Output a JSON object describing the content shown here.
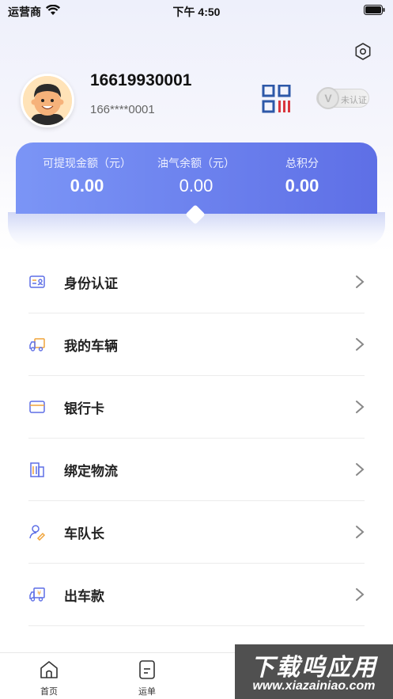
{
  "status_bar": {
    "carrier": "运营商",
    "time": "下午 4:50"
  },
  "profile": {
    "phone": "16619930001",
    "phone_masked": "166****0001",
    "verify_status": "未认证",
    "verify_letter": "V"
  },
  "balances": [
    {
      "label": "可提现金额（元）",
      "value": "0.00"
    },
    {
      "label": "油气余额（元）",
      "value": "0.00"
    },
    {
      "label": "总积分",
      "value": "0.00"
    }
  ],
  "menu": [
    {
      "label": "身份认证",
      "icon": "id-card-icon"
    },
    {
      "label": "我的车辆",
      "icon": "truck-icon"
    },
    {
      "label": "银行卡",
      "icon": "bank-card-icon"
    },
    {
      "label": "绑定物流",
      "icon": "building-icon"
    },
    {
      "label": "车队长",
      "icon": "fleet-leader-icon"
    },
    {
      "label": "出车款",
      "icon": "truck-payment-icon"
    }
  ],
  "tabs": [
    {
      "label": "首页",
      "icon": "home-icon"
    },
    {
      "label": "运单",
      "icon": "waybill-icon"
    }
  ],
  "watermark": {
    "main": "下载呜应用",
    "url": "www.xiazainiao.com"
  },
  "colors": {
    "accent": "#5e6fe6",
    "accent_light": "#7b95f6",
    "qr_blue": "#2d58a8",
    "qr_red": "#d9363e"
  }
}
